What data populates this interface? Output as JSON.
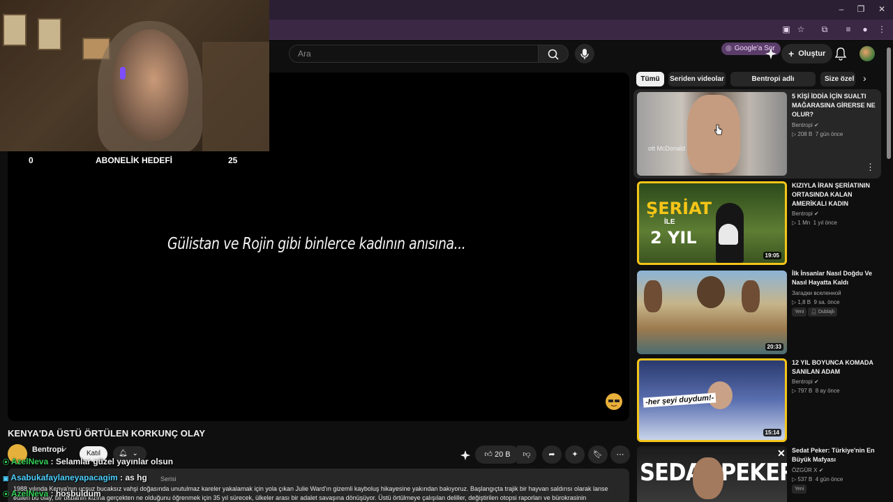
{
  "browser": {
    "google_sor": "Google'a Sor",
    "window_controls": [
      "–",
      "❐",
      "✕"
    ]
  },
  "youtube": {
    "search_placeholder": "Ara",
    "create_label": "Oluştur"
  },
  "player": {
    "overlay_text": "Gülistan ve Rojin gibi binlerce kadının anısına...",
    "subscription_goal": {
      "start": "0",
      "label": "ABONELİK HEDEFİ",
      "end": "25"
    }
  },
  "video": {
    "title": "KENYA'DA ÜSTÜ ÖRTÜLEN KORKUNÇ OLAY",
    "channel": "Bentropi",
    "join_label": "Katıl",
    "likes": "20 B",
    "meta_partial": "Serisi",
    "description_line1": "1988 yılında Kenya'nın ucsuz bucaksız vahşi doğasında unutulmaz kareler yakalamak için yola çıkan Julie Ward'ın gizemli kayboluş hikayesine yakından bakıyoruz. Başlangıçta trajik bir hayvan saldırısı olarak lanse",
    "description_line2": "edilen bu olay, bir babanın kızına gerçekten ne olduğunu öğrenmek için 35 yıl sürecek, ülkeler arası bir adalet savaşına dönüşüyor. Üstü örtülmeye çalışılan deliller, değiştirilen otopsi raporları ve bürokrasinin"
  },
  "chat": [
    {
      "user": "AzelNeva",
      "message": ": Selamlar güzel yayınlar olsun"
    },
    {
      "user": "Asabukafaylaneyapacagim",
      "message": ": as hg"
    },
    {
      "user": "AzelNeva",
      "message": ": hoşbuldum"
    }
  ],
  "sidebar": {
    "chips": [
      "Tümü",
      "Seriden videolar",
      "Bentropi adlı yükleyiciden",
      "Size özel"
    ],
    "videos": [
      {
        "title": "5 KİŞİ İDDİA İÇİN SUALTI MAĞARASINA GİRERSE NE OLUR?",
        "channel": "Bentropi",
        "views": "208 B",
        "age": "7 gün önce",
        "duration": "",
        "thumb_text": "ott McDonald"
      },
      {
        "title": "KIZIYLA İRAN ŞERİATININ ORTASINDA KALAN AMERİKALI KADIN",
        "channel": "Bentropi",
        "views": "1 Mn",
        "age": "1 yıl önce",
        "duration": "19:05",
        "thumb_text": "ŞERİAT",
        "thumb_text2": "İLE",
        "thumb_text3": "2 YIL"
      },
      {
        "title": "İlk İnsanlar Nasıl Doğdu Ve Nasıl Hayatta Kaldı",
        "channel": "Загадки вселенной",
        "views": "1,8 B",
        "age": "9 sa. önce",
        "duration": "20:33",
        "badges": [
          "Yeni",
          "Dublajlı"
        ]
      },
      {
        "title": "12 YIL BOYUNCA KOMADA SANILAN ADAM",
        "channel": "Bentropi",
        "views": "797 B",
        "age": "8 ay önce",
        "duration": "15:14",
        "thumb_text": "-her şeyi duydum!-"
      },
      {
        "title": "Sedat Peker: Türkiye'nin En Büyük Mafyası",
        "channel": "ÖZGÜR X",
        "views": "537 B",
        "age": "4 gün önce",
        "duration": "",
        "thumb_text": "SEDAT PEKER",
        "badges": [
          "Yeni"
        ]
      }
    ]
  },
  "colors": {
    "accent_yellow": "#f5c518",
    "chat_green": "#34d058",
    "chat_cyan": "#4fd1ff"
  }
}
